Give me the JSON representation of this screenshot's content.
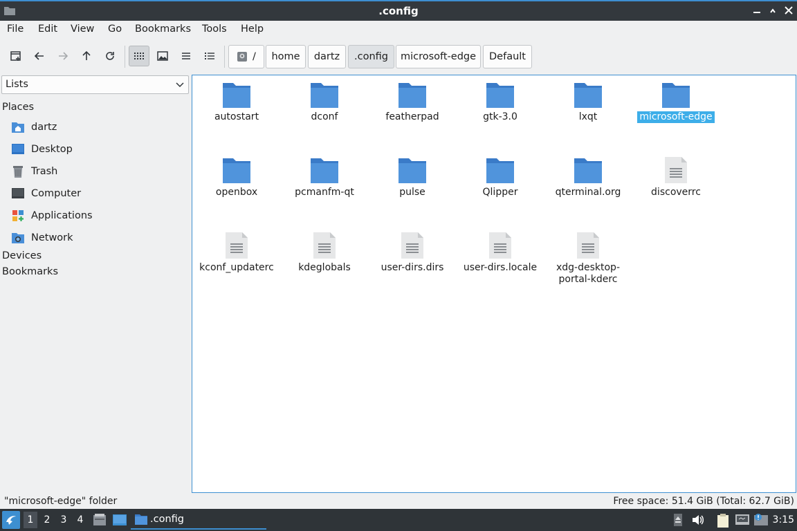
{
  "window": {
    "title": ".config"
  },
  "menu": [
    "File",
    "Edit",
    "Go",
    "Bookmarks",
    "Tools",
    "Help",
    "View"
  ],
  "menu_items": {
    "file": "File",
    "edit": "Edit",
    "view": "View",
    "go": "Go",
    "bookmarks": "Bookmarks",
    "tools": "Tools",
    "help": "Help"
  },
  "breadcrumb": {
    "root": "/",
    "c1": "home",
    "c2": "dartz",
    "c3": ".config",
    "c4": "microsoft-edge",
    "c5": "Default"
  },
  "side": {
    "mode": "Lists",
    "places_header": "Places",
    "devices_header": "Devices",
    "bookmarks_header": "Bookmarks",
    "places": [
      {
        "label": "dartz",
        "icon": "home-folder-icon"
      },
      {
        "label": "Desktop",
        "icon": "desktop-icon"
      },
      {
        "label": "Trash",
        "icon": "trash-icon"
      },
      {
        "label": "Computer",
        "icon": "computer-icon"
      },
      {
        "label": "Applications",
        "icon": "applications-icon"
      },
      {
        "label": "Network",
        "icon": "network-icon"
      }
    ]
  },
  "files": [
    {
      "name": "autostart",
      "type": "folder"
    },
    {
      "name": "dconf",
      "type": "folder"
    },
    {
      "name": "featherpad",
      "type": "folder"
    },
    {
      "name": "gtk-3.0",
      "type": "folder"
    },
    {
      "name": "lxqt",
      "type": "folder"
    },
    {
      "name": "microsoft-edge",
      "type": "folder",
      "selected": true
    },
    {
      "name": "openbox",
      "type": "folder"
    },
    {
      "name": "pcmanfm-qt",
      "type": "folder"
    },
    {
      "name": "pulse",
      "type": "folder"
    },
    {
      "name": "Qlipper",
      "type": "folder"
    },
    {
      "name": "qterminal.org",
      "type": "folder"
    },
    {
      "name": "discoverrc",
      "type": "file"
    },
    {
      "name": "kconf_updaterc",
      "type": "file"
    },
    {
      "name": "kdeglobals",
      "type": "file"
    },
    {
      "name": "user-dirs.dirs",
      "type": "file"
    },
    {
      "name": "user-dirs.locale",
      "type": "file"
    },
    {
      "name": "xdg-desktop-portal-kderc",
      "type": "file",
      "display_lines": [
        "xdg-desktop-",
        "portal-kderc"
      ]
    }
  ],
  "status": {
    "selection": "\"microsoft-edge\" folder",
    "free_space": "Free space: 51.4 GiB (Total: 62.7 GiB)"
  },
  "taskbar": {
    "workspaces": [
      "1",
      "2",
      "3",
      "4"
    ],
    "active_workspace": "1",
    "task_label": ".config",
    "clock": "3:15"
  },
  "colors": {
    "folder": "#4a8fd8",
    "selection": "#3daee9",
    "accent": "#3d8fd1",
    "titlebar": "#33383d"
  }
}
